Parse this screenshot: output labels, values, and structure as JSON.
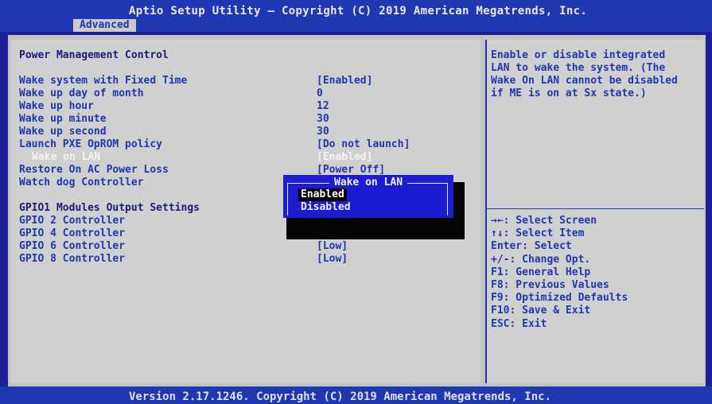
{
  "header": {
    "title": "Aptio Setup Utility – Copyright (C) 2019 American Megatrends, Inc.",
    "active_tab": "Advanced"
  },
  "main": {
    "section_title": "Power Management Control",
    "settings": [
      {
        "label": "Wake system with Fixed Time",
        "value": "[Enabled]"
      },
      {
        "label": "Wake up day of month",
        "value": "0"
      },
      {
        "label": "Wake up hour",
        "value": "12"
      },
      {
        "label": "Wake up minute",
        "value": "30"
      },
      {
        "label": "Wake up second",
        "value": "30"
      },
      {
        "label": "Launch PXE OpROM policy",
        "value": "[Do not launch]"
      },
      {
        "label": "Wake on LAN",
        "value": "[Enabled]"
      },
      {
        "label": "Restore On AC Power Loss",
        "value": "[Power Off]"
      },
      {
        "label": "Watch dog Controller",
        "value": ""
      }
    ],
    "gpio_title": "GPIO1 Modules Output Settings",
    "gpio": [
      {
        "label": "GPIO 2 Controller",
        "value": ""
      },
      {
        "label": "GPIO 4 Controller",
        "value": ""
      },
      {
        "label": "GPIO 6 Controller",
        "value": "[Low]"
      },
      {
        "label": "GPIO 8 Controller",
        "value": "[Low]"
      }
    ]
  },
  "popup": {
    "title": "Wake on LAN",
    "options": [
      "Enabled",
      "Disabled"
    ],
    "selected": "Enabled"
  },
  "help": {
    "lines": [
      "Enable or disable integrated",
      "LAN to wake the system. (The",
      "Wake On LAN cannot be disabled",
      "if ME is on at Sx state.)"
    ]
  },
  "keys": [
    "→←: Select Screen",
    "↑↓: Select Item",
    "Enter: Select",
    "+/-: Change Opt.",
    "F1: General Help",
    "F8: Previous Values",
    "F9: Optimized Defaults",
    "F10: Save & Exit",
    "ESC: Exit"
  ],
  "footer": {
    "text": "Version 2.17.1246. Copyright (C) 2019 American Megatrends, Inc."
  }
}
